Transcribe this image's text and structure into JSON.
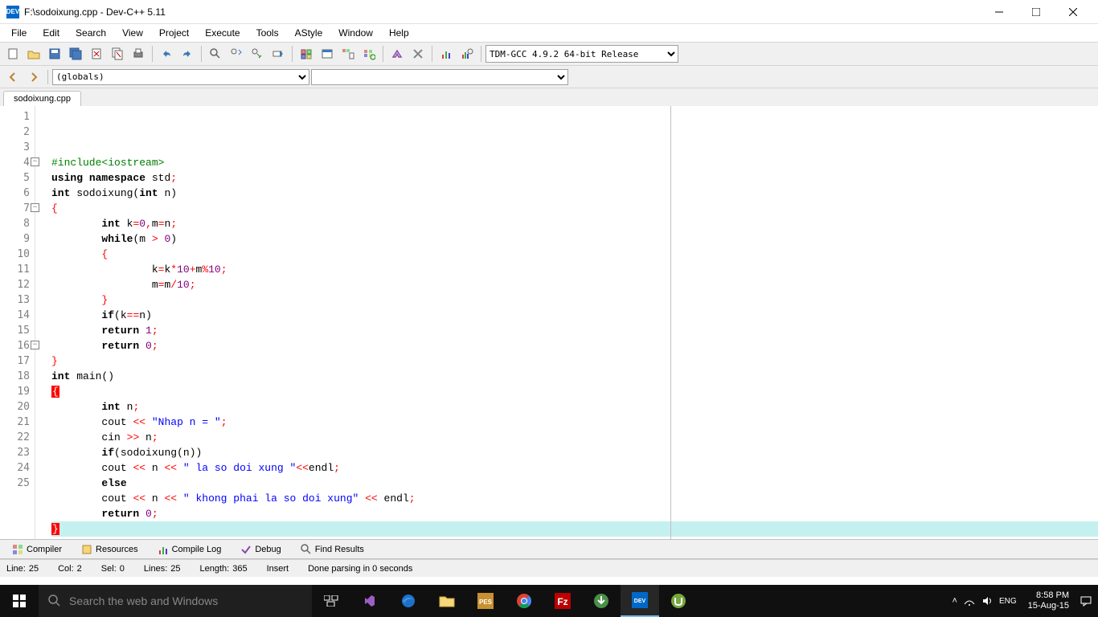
{
  "window": {
    "title": "F:\\sodoixung.cpp - Dev-C++ 5.11",
    "app_icon_label": "DEV"
  },
  "menu": [
    "File",
    "Edit",
    "Search",
    "View",
    "Project",
    "Execute",
    "Tools",
    "AStyle",
    "Window",
    "Help"
  ],
  "toolbar": {
    "compiler_select": "TDM-GCC 4.9.2 64-bit Release"
  },
  "navbar": {
    "scope_select": "(globals)"
  },
  "tabs": [
    "sodoixung.cpp"
  ],
  "code_lines": [
    {
      "n": 1,
      "tokens": [
        {
          "t": "#include",
          "c": "pp"
        },
        {
          "t": "<iostream>",
          "c": "pp"
        }
      ]
    },
    {
      "n": 2,
      "tokens": [
        {
          "t": "using",
          "c": "kw"
        },
        {
          "t": " ",
          "c": "id"
        },
        {
          "t": "namespace",
          "c": "kw"
        },
        {
          "t": " std",
          "c": "id"
        },
        {
          "t": ";",
          "c": "op"
        }
      ]
    },
    {
      "n": 3,
      "tokens": [
        {
          "t": "int",
          "c": "kw"
        },
        {
          "t": " sodoixung",
          "c": "id"
        },
        {
          "t": "(",
          "c": "paren"
        },
        {
          "t": "int",
          "c": "kw"
        },
        {
          "t": " n",
          "c": "id"
        },
        {
          "t": ")",
          "c": "paren"
        }
      ]
    },
    {
      "n": 4,
      "fold": true,
      "tokens": [
        {
          "t": "{",
          "c": "brace"
        }
      ]
    },
    {
      "n": 5,
      "indent": 2,
      "tokens": [
        {
          "t": "int",
          "c": "kw"
        },
        {
          "t": " k",
          "c": "id"
        },
        {
          "t": "=",
          "c": "op"
        },
        {
          "t": "0",
          "c": "num"
        },
        {
          "t": ",",
          "c": "op"
        },
        {
          "t": "m",
          "c": "id"
        },
        {
          "t": "=",
          "c": "op"
        },
        {
          "t": "n",
          "c": "id"
        },
        {
          "t": ";",
          "c": "op"
        }
      ]
    },
    {
      "n": 6,
      "indent": 2,
      "tokens": [
        {
          "t": "while",
          "c": "kw"
        },
        {
          "t": "(",
          "c": "paren"
        },
        {
          "t": "m ",
          "c": "id"
        },
        {
          "t": ">",
          "c": "op"
        },
        {
          "t": " ",
          "c": "id"
        },
        {
          "t": "0",
          "c": "num"
        },
        {
          "t": ")",
          "c": "paren"
        }
      ]
    },
    {
      "n": 7,
      "fold": true,
      "indent": 2,
      "tokens": [
        {
          "t": "{",
          "c": "brace"
        }
      ]
    },
    {
      "n": 8,
      "indent": 4,
      "tokens": [
        {
          "t": "k",
          "c": "id"
        },
        {
          "t": "=",
          "c": "op"
        },
        {
          "t": "k",
          "c": "id"
        },
        {
          "t": "*",
          "c": "op"
        },
        {
          "t": "10",
          "c": "num"
        },
        {
          "t": "+",
          "c": "op"
        },
        {
          "t": "m",
          "c": "id"
        },
        {
          "t": "%",
          "c": "op"
        },
        {
          "t": "10",
          "c": "num"
        },
        {
          "t": ";",
          "c": "op"
        }
      ]
    },
    {
      "n": 9,
      "indent": 4,
      "tokens": [
        {
          "t": "m",
          "c": "id"
        },
        {
          "t": "=",
          "c": "op"
        },
        {
          "t": "m",
          "c": "id"
        },
        {
          "t": "/",
          "c": "op"
        },
        {
          "t": "10",
          "c": "num"
        },
        {
          "t": ";",
          "c": "op"
        }
      ]
    },
    {
      "n": 10,
      "indent": 2,
      "tokens": [
        {
          "t": "}",
          "c": "brace"
        }
      ]
    },
    {
      "n": 11,
      "indent": 2,
      "tokens": [
        {
          "t": "if",
          "c": "kw"
        },
        {
          "t": "(",
          "c": "paren"
        },
        {
          "t": "k",
          "c": "id"
        },
        {
          "t": "==",
          "c": "op"
        },
        {
          "t": "n",
          "c": "id"
        },
        {
          "t": ")",
          "c": "paren"
        }
      ]
    },
    {
      "n": 12,
      "indent": 2,
      "tokens": [
        {
          "t": "return",
          "c": "kw"
        },
        {
          "t": " ",
          "c": "id"
        },
        {
          "t": "1",
          "c": "num"
        },
        {
          "t": ";",
          "c": "op"
        }
      ]
    },
    {
      "n": 13,
      "indent": 2,
      "tokens": [
        {
          "t": "return",
          "c": "kw"
        },
        {
          "t": " ",
          "c": "id"
        },
        {
          "t": "0",
          "c": "num"
        },
        {
          "t": ";",
          "c": "op"
        }
      ]
    },
    {
      "n": 14,
      "tokens": [
        {
          "t": "}",
          "c": "brace"
        }
      ]
    },
    {
      "n": 15,
      "tokens": [
        {
          "t": "int",
          "c": "kw"
        },
        {
          "t": " main",
          "c": "id"
        },
        {
          "t": "(",
          "c": "paren"
        },
        {
          "t": ")",
          "c": "paren"
        }
      ]
    },
    {
      "n": 16,
      "fold": true,
      "tokens": [
        {
          "t": "{",
          "c": "hlbrace"
        }
      ]
    },
    {
      "n": 17,
      "indent": 2,
      "tokens": [
        {
          "t": "int",
          "c": "kw"
        },
        {
          "t": " n",
          "c": "id"
        },
        {
          "t": ";",
          "c": "op"
        }
      ]
    },
    {
      "n": 18,
      "indent": 2,
      "tokens": [
        {
          "t": "cout ",
          "c": "id"
        },
        {
          "t": "<<",
          "c": "op"
        },
        {
          "t": " ",
          "c": "id"
        },
        {
          "t": "\"Nhap n = \"",
          "c": "str"
        },
        {
          "t": ";",
          "c": "op"
        }
      ]
    },
    {
      "n": 19,
      "indent": 2,
      "tokens": [
        {
          "t": "cin ",
          "c": "id"
        },
        {
          "t": ">>",
          "c": "op"
        },
        {
          "t": " n",
          "c": "id"
        },
        {
          "t": ";",
          "c": "op"
        }
      ]
    },
    {
      "n": 20,
      "indent": 2,
      "tokens": [
        {
          "t": "if",
          "c": "kw"
        },
        {
          "t": "(",
          "c": "paren"
        },
        {
          "t": "sodoixung",
          "c": "id"
        },
        {
          "t": "(",
          "c": "paren"
        },
        {
          "t": "n",
          "c": "id"
        },
        {
          "t": ")",
          "c": "paren"
        },
        {
          "t": ")",
          "c": "paren"
        }
      ]
    },
    {
      "n": 21,
      "indent": 2,
      "tokens": [
        {
          "t": "cout ",
          "c": "id"
        },
        {
          "t": "<<",
          "c": "op"
        },
        {
          "t": " n ",
          "c": "id"
        },
        {
          "t": "<<",
          "c": "op"
        },
        {
          "t": " ",
          "c": "id"
        },
        {
          "t": "\" la so doi xung \"",
          "c": "str"
        },
        {
          "t": "<<",
          "c": "op"
        },
        {
          "t": "endl",
          "c": "id"
        },
        {
          "t": ";",
          "c": "op"
        }
      ]
    },
    {
      "n": 22,
      "indent": 2,
      "tokens": [
        {
          "t": "else",
          "c": "kw"
        }
      ]
    },
    {
      "n": 23,
      "indent": 2,
      "tokens": [
        {
          "t": "cout ",
          "c": "id"
        },
        {
          "t": "<<",
          "c": "op"
        },
        {
          "t": " n ",
          "c": "id"
        },
        {
          "t": "<<",
          "c": "op"
        },
        {
          "t": " ",
          "c": "id"
        },
        {
          "t": "\" khong phai la so doi xung\"",
          "c": "str"
        },
        {
          "t": " ",
          "c": "id"
        },
        {
          "t": "<<",
          "c": "op"
        },
        {
          "t": " endl",
          "c": "id"
        },
        {
          "t": ";",
          "c": "op"
        }
      ]
    },
    {
      "n": 24,
      "indent": 2,
      "tokens": [
        {
          "t": "return",
          "c": "kw"
        },
        {
          "t": " ",
          "c": "id"
        },
        {
          "t": "0",
          "c": "num"
        },
        {
          "t": ";",
          "c": "op"
        }
      ]
    },
    {
      "n": 25,
      "hl": true,
      "tokens": [
        {
          "t": "}",
          "c": "hlbrace"
        }
      ]
    }
  ],
  "bottom_tabs": [
    {
      "icon": "grid",
      "label": "Compiler"
    },
    {
      "icon": "resources",
      "label": "Resources"
    },
    {
      "icon": "chart",
      "label": "Compile Log"
    },
    {
      "icon": "check",
      "label": "Debug"
    },
    {
      "icon": "search",
      "label": "Find Results"
    }
  ],
  "status": {
    "line_label": "Line:",
    "line_val": "25",
    "col_label": "Col:",
    "col_val": "2",
    "sel_label": "Sel:",
    "sel_val": "0",
    "lines_label": "Lines:",
    "lines_val": "25",
    "length_label": "Length:",
    "length_val": "365",
    "mode": "Insert",
    "msg": "Done parsing in 0 seconds"
  },
  "taskbar": {
    "search_placeholder": "Search the web and Windows",
    "time": "8:58 PM",
    "date": "15-Aug-15"
  }
}
